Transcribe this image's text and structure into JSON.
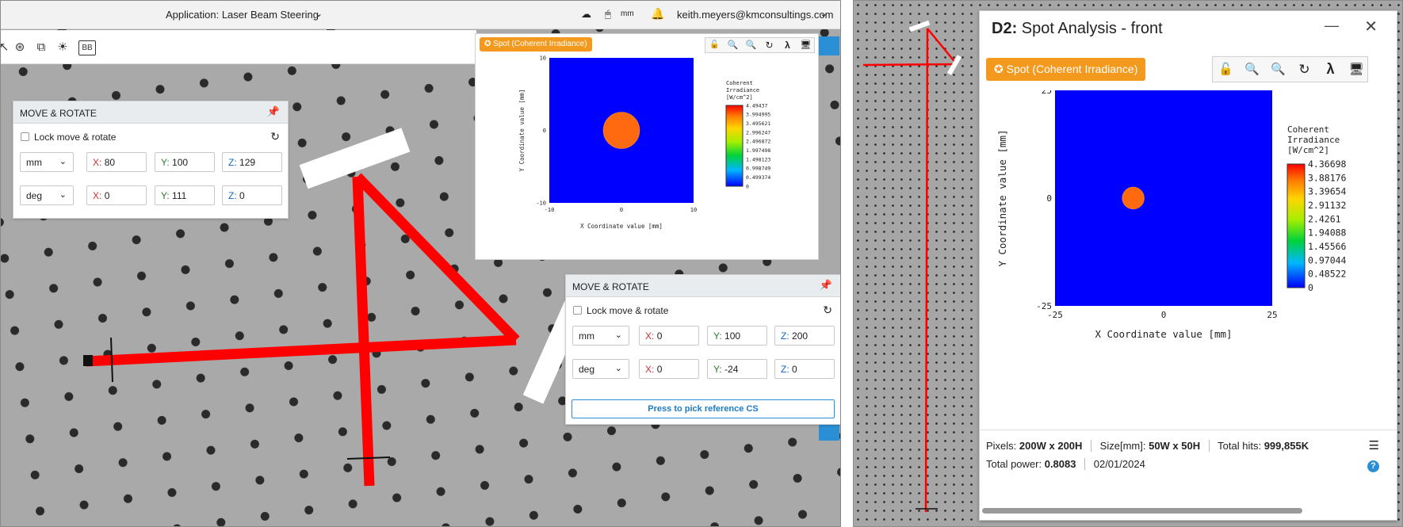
{
  "header": {
    "app_title": "Application: Laser Beam Steering",
    "units": "mm",
    "user": "keith.meyers@kmconsultings.com"
  },
  "toolbar": {
    "icons": [
      "cursor-icon",
      "beam-source-icon",
      "detector-icon",
      "light-icon",
      "bounding-box-icon"
    ],
    "bb_label": "BB"
  },
  "move_rotate_panels": [
    {
      "title": "MOVE & ROTATE",
      "lock_label": "Lock move & rotate",
      "position": {
        "unit": "mm",
        "x_label": "X:",
        "x": "80",
        "y_label": "Y:",
        "y": "100",
        "z_label": "Z:",
        "z": "129"
      },
      "rotation": {
        "unit": "deg",
        "x_label": "X:",
        "x": "0",
        "y_label": "Y:",
        "y": "111",
        "z_label": "Z:",
        "z": "0"
      }
    },
    {
      "title": "MOVE & ROTATE",
      "lock_label": "Lock move & rotate",
      "position": {
        "unit": "mm",
        "x_label": "X:",
        "x": "0",
        "y_label": "Y:",
        "y": "100",
        "z_label": "Z:",
        "z": "200"
      },
      "rotation": {
        "unit": "deg",
        "x_label": "X:",
        "x": "0",
        "y_label": "Y:",
        "y": "-24",
        "z_label": "Z:",
        "z": "0"
      },
      "pick_button": "Press to pick reference CS"
    }
  ],
  "small_spot": {
    "badge": "Spot (Coherent Irradiance)",
    "lambda": "λ"
  },
  "d2_window": {
    "title_bold": "D2:",
    "title_rest": " Spot Analysis - front",
    "badge": "Spot (Coherent Irradiance)",
    "lambda": "λ",
    "status": {
      "pixels_label": "Pixels:",
      "pixels": "200W x 200H",
      "size_label": "Size[mm]:",
      "size": "50W x 50H",
      "hits_label": "Total hits:",
      "hits": "999,855K",
      "power_label": "Total power:",
      "power": "0.8083",
      "date": "02/01/2024"
    }
  },
  "chart_data": [
    {
      "type": "heatmap",
      "title": "",
      "xlabel": "X Coordinate value [mm]",
      "ylabel": "Y Coordinate value [mm]",
      "xlim": [
        -10,
        10
      ],
      "ylim": [
        -10,
        10
      ],
      "x_ticks": [
        "-10",
        "0",
        "10"
      ],
      "y_ticks": [
        "10",
        "0",
        "-10"
      ],
      "colorbar_title": [
        "Coherent",
        "Irradiance",
        "[W/cm^2]"
      ],
      "colorbar_ticks": [
        "4.49437",
        "3.994995",
        "3.495621",
        "2.996247",
        "2.496872",
        "1.997498",
        "1.498123",
        "0.998749",
        "0.499374",
        "0"
      ],
      "spot": {
        "center_x": 0,
        "center_y": 0,
        "radius": 2.5,
        "value": 3.9
      }
    },
    {
      "type": "heatmap",
      "title": "",
      "xlabel": "X Coordinate value [mm]",
      "ylabel": "Y Coordinate value [mm]",
      "xlim": [
        -25,
        25
      ],
      "ylim": [
        -25,
        25
      ],
      "x_ticks": [
        "-25",
        "0",
        "25"
      ],
      "y_ticks": [
        "25",
        "0",
        "-25"
      ],
      "colorbar_title": [
        "Coherent",
        "Irradiance",
        "[W/cm^2]"
      ],
      "colorbar_ticks": [
        "4.36698",
        "3.88176",
        "3.39654",
        "2.91132",
        "2.4261",
        "1.94088",
        "1.45566",
        "0.97044",
        "0.48522",
        "0"
      ],
      "spot": {
        "center_x": -7,
        "center_y": 0,
        "radius": 2.5,
        "value": 3.9
      }
    }
  ]
}
